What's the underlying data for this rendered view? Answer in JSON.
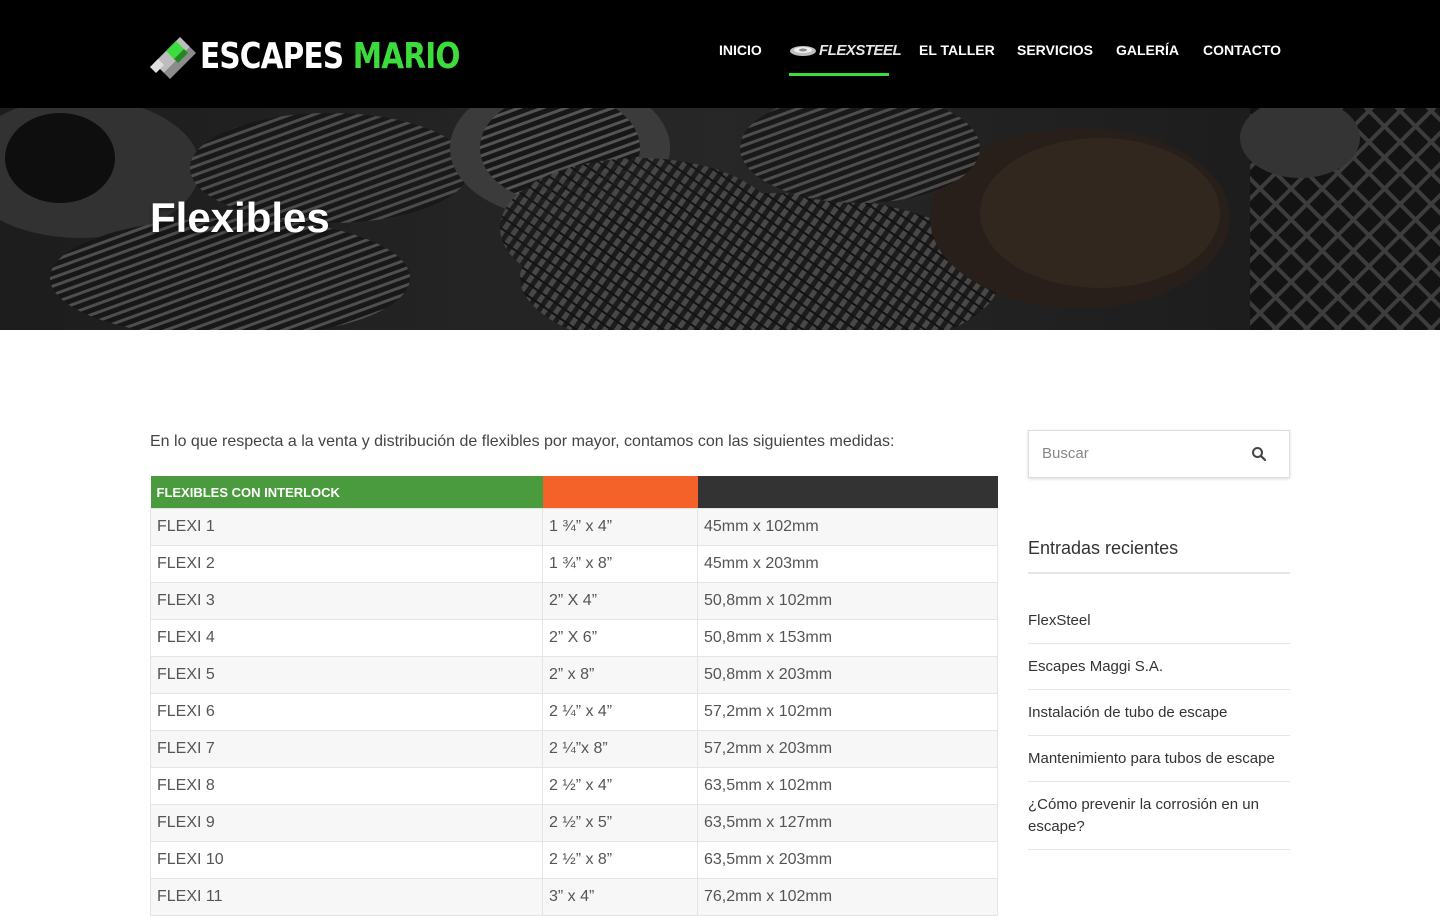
{
  "header": {
    "logo_text_white": "ESCAPES",
    "logo_text_green": "MARIO",
    "nav": [
      {
        "label": "INICIO"
      },
      {
        "label": "FLEXSTEEL"
      },
      {
        "label": "EL TALLER"
      },
      {
        "label": "SERVICIOS"
      },
      {
        "label": "GALERÍA"
      },
      {
        "label": "CONTACTO"
      }
    ],
    "active_nav": "FLEXSTEEL"
  },
  "hero": {
    "title": "Flexibles"
  },
  "main": {
    "intro": "En lo que respecta a la venta y distribución de flexibles por mayor, contamos con las siguientes medidas:",
    "table": {
      "headers": [
        "FLEXIBLES CON INTERLOCK",
        "",
        ""
      ],
      "header_colors": [
        "#4a9b3d",
        "#f4622a",
        "#333333"
      ],
      "rows": [
        [
          "FLEXI 1",
          "1 ¾” x 4”",
          "45mm x 102mm"
        ],
        [
          "FLEXI 2",
          "1 ¾” x 8”",
          "45mm x 203mm"
        ],
        [
          "FLEXI 3",
          "2” X 4”",
          "50,8mm x 102mm"
        ],
        [
          "FLEXI 4",
          "2” X 6”",
          "50,8mm x 153mm"
        ],
        [
          "FLEXI 5",
          "2” x 8”",
          "50,8mm x 203mm"
        ],
        [
          "FLEXI 6",
          "2 ¼” x 4”",
          "57,2mm x 102mm"
        ],
        [
          "FLEXI 7",
          "2 ¼”x 8”",
          "57,2mm x 203mm"
        ],
        [
          "FLEXI 8",
          "2 ½” x 4”",
          "63,5mm x 102mm"
        ],
        [
          "FLEXI 9",
          "2 ½” x 5”",
          "63,5mm x 127mm"
        ],
        [
          "FLEXI 10",
          "2 ½” x 8”",
          "63,5mm x 203mm"
        ],
        [
          "FLEXI 11",
          "3” x 4”",
          "76,2mm x 102mm"
        ]
      ]
    }
  },
  "sidebar": {
    "search_placeholder": "Buscar",
    "recent_title": "Entradas recientes",
    "recent_posts": [
      "FlexSteel",
      "Escapes Maggi S.A.",
      "Instalación de tubo de escape",
      "Mantenimiento para tubos de escape",
      "¿Cómo prevenir la corrosión en un escape?"
    ]
  },
  "colors": {
    "brand_green": "#3ddc3d",
    "header_bg": "#000000",
    "table_green": "#4a9b3d",
    "table_orange": "#f4622a",
    "table_dark": "#333333"
  }
}
